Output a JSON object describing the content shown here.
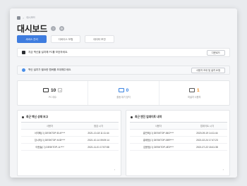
{
  "breadcrumb": {
    "home": "홈",
    "sep": ">",
    "current": "대시보드"
  },
  "header": {
    "title": "대시보드",
    "btn1": "?",
    "btn2": "⚙"
  },
  "tabs": [
    {
      "label": "서버스 관리"
    },
    {
      "label": "디바이스 보험"
    },
    {
      "label": "데이터 보안"
    }
  ],
  "notice1": {
    "text": "지금 백신을 설치해 PC를 보호하세요.",
    "button": "다운로드"
  },
  "notice2": {
    "text": "백신 설치가 필요한 멤버를 초대해주세요.",
    "button": "사용자 초대 및 설치 요청"
  },
  "stats": [
    {
      "value": "10",
      "label": "PC 대수",
      "plus": "+"
    },
    {
      "value": "0",
      "label": "출동 대기 장치"
    },
    {
      "value": "1",
      "label": "미설치 사용자"
    }
  ],
  "left_panel": {
    "title": "최근 백신 상태 보고",
    "columns": [
      "사용자",
      "점검 시각"
    ],
    "rows": [
      [
        "서지혜(☐) DESKTOP-ELK****",
        "2021-10-18 11:11:44"
      ],
      [
        "임시하(☐) DESKTOP-HJD****",
        "2021-10-14 09:09:14"
      ],
      [
        "이한솔(☐) DESKTOP-JL****",
        "2021-11-01 17:57:58"
      ]
    ],
    "more": "›"
  },
  "right_panel": {
    "title": "최근 엔진 업데이트 내역",
    "columns": [
      "사용자",
      "업데이트 시각"
    ],
    "rows": [
      [
        "홍민희(☐) DESKTOP-06G****",
        "2020-09-19 14:11:44"
      ],
      [
        "홍태정(☐) DESKTOP-05R****",
        "2021-02-24 17:47:23"
      ],
      [
        "김윤정(☐) DESKTOP-4E3****",
        "2021-07-22 18:41:38"
      ]
    ],
    "more": "›"
  },
  "colors": {
    "accent": "#3e7cdf",
    "blue": "#2f7fe6",
    "orange": "#f08a1c"
  }
}
